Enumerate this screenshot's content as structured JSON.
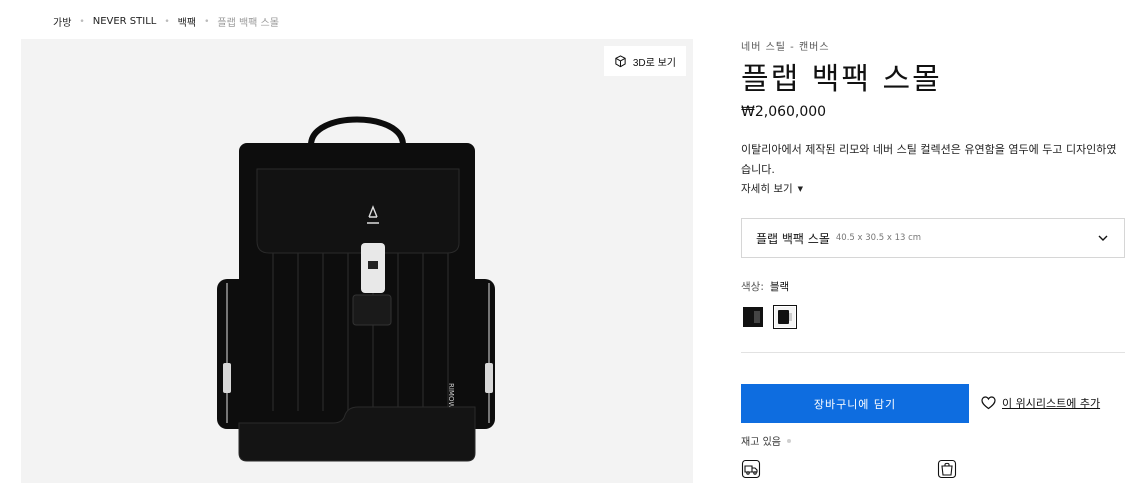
{
  "breadcrumb": [
    {
      "label": "가방"
    },
    {
      "label": "NEVER STILL"
    },
    {
      "label": "백팩"
    },
    {
      "label": "플랩 백팩 스몰"
    }
  ],
  "gallery": {
    "view_3d_label": "3D로 보기",
    "brand_mark": "RIMOWA"
  },
  "product": {
    "collection": "네버 스틸 - 캔버스",
    "title": "플랩 백팩 스몰",
    "price": "₩2,060,000",
    "description": "이탈리아에서 제작된 리모와 네버 스틸 컬렉션은 유연함을 염두에 두고 디자인하였습니다.",
    "more_label": "자세히 보기",
    "size": {
      "name": "플랩 백팩 스몰",
      "dims": "40.5 x 30.5 x 13 cm"
    },
    "color": {
      "key": "색상:",
      "value": "블랙"
    },
    "swatches": [
      {
        "name": "black",
        "color": "#111111"
      },
      {
        "name": "black-white",
        "color": "#111111",
        "selected": true
      }
    ],
    "add_to_cart": "장바구니에 담기",
    "wishlist": "이 위시리스트에 추가",
    "stock": "재고 있음"
  },
  "colors": {
    "accent": "#0e6de0",
    "bag": "#0d0d0d"
  }
}
